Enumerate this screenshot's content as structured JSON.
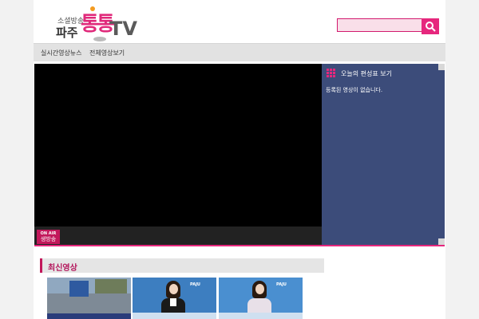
{
  "logo": {
    "small_text": "소셜방송",
    "paju_text": "파주",
    "tongtong_text": "통통",
    "tv_text": "TV"
  },
  "search": {
    "value": "",
    "placeholder": ""
  },
  "nav": {
    "items": [
      "실시간영상뉴스",
      "전체영상보기"
    ]
  },
  "player": {
    "onair_label": "ON AIR",
    "live_label": "생방송"
  },
  "schedule": {
    "title": "오늘의 편성표 보기",
    "empty_message": "등록된 영상이 없습니다."
  },
  "latest": {
    "section_title": "최신영상",
    "thumbnails": [
      {
        "label": ""
      },
      {
        "label": "PAJU"
      },
      {
        "label": "PAJU"
      }
    ]
  },
  "colors": {
    "accent": "#e6277d",
    "schedule_bg": "#3c4c7a",
    "nav_bg": "#e2e2e2"
  }
}
